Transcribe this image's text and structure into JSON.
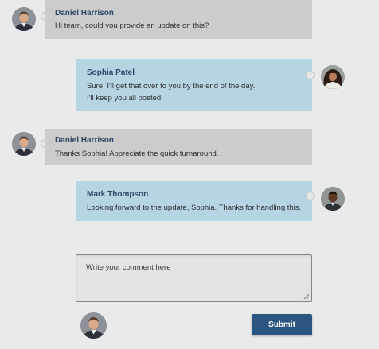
{
  "messages": [
    {
      "author": "Daniel Harrison",
      "side": "left",
      "avatar": "user-avatar-daniel",
      "lines": [
        "Hi team, could you provide an update on this?"
      ]
    },
    {
      "author": "Sophia Patel",
      "side": "right",
      "avatar": "user-avatar-sophia",
      "lines": [
        "Sure, I'll get that over to you by the end of the day.",
        "I'll keep you all posted."
      ]
    },
    {
      "author": "Daniel Harrison",
      "side": "left",
      "avatar": "user-avatar-daniel",
      "lines": [
        "Thanks Sophia! Appreciate the quick turnaround."
      ]
    },
    {
      "author": "Mark Thompson",
      "side": "right",
      "avatar": "user-avatar-mark",
      "lines": [
        "Looking forward to the update, Sophia. Thanks for handling this."
      ]
    }
  ],
  "composer": {
    "placeholder": "Write your comment here",
    "value": ""
  },
  "submit_label": "Submit",
  "colors": {
    "page_bg": "#e9eaeb",
    "left_bubble": "#cccccc",
    "right_bubble": "#b6d5e3",
    "name_text": "#2f4868",
    "submit_bg": "#2d5581"
  }
}
